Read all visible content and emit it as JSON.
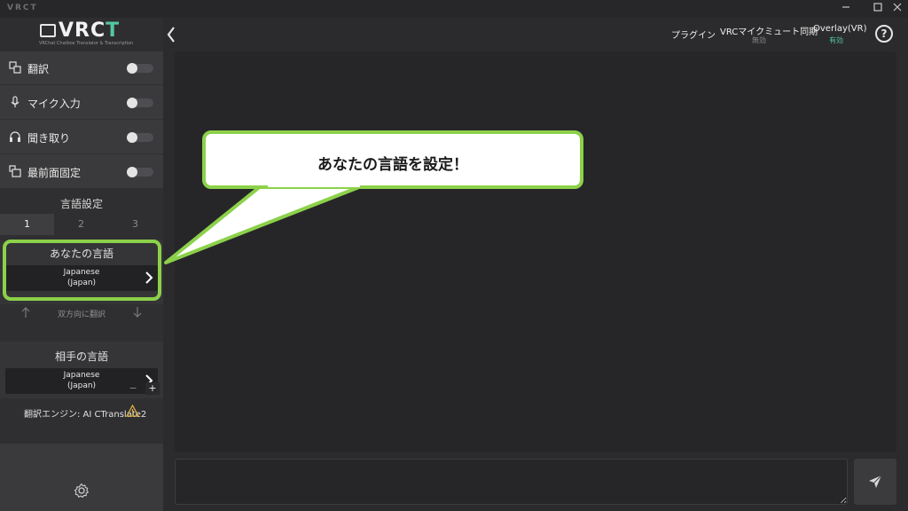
{
  "window": {
    "title": "VRCT"
  },
  "logo": {
    "text_main": "VRC",
    "text_accent": "T",
    "subtitle": "VRChat Chatbox Translator & Transcription"
  },
  "sidebar": {
    "toggles": [
      {
        "label": "翻訳",
        "icon": "translate-icon",
        "enabled": false
      },
      {
        "label": "マイク入力",
        "icon": "microphone-icon",
        "enabled": false
      },
      {
        "label": "聞き取り",
        "icon": "headphones-icon",
        "enabled": false
      },
      {
        "label": "最前面固定",
        "icon": "window-pin-icon",
        "enabled": false
      }
    ],
    "language_settings": {
      "title": "言語設定",
      "tabs": [
        "1",
        "2",
        "3"
      ],
      "active_tab": "1",
      "your_language": {
        "caption": "あなたの言語",
        "value_line1": "Japanese",
        "value_line2": "(Japan)"
      },
      "swap_label": "双方向に翻訳",
      "target_language": {
        "caption": "相手の言語",
        "value_line1": "Japanese",
        "value_line2": "(Japan)"
      },
      "minus_label": "−",
      "plus_label": "+"
    },
    "engine_label": "翻訳エンジン: AI CTranslate2"
  },
  "header": {
    "plugin_label": "プラグイン",
    "mic_mute_sync": {
      "label": "VRCマイクミュート同期",
      "status": "無効"
    },
    "overlay": {
      "label": "Overlay(VR)",
      "status": "有効"
    },
    "help_label": "?"
  },
  "message_input": {
    "value": "",
    "placeholder": ""
  },
  "callout": {
    "text": "あなたの言語を設定！"
  },
  "colors": {
    "accent_green": "#8cd14a",
    "enabled_status": "#53c6a0",
    "disabled_status": "#8a8a8c",
    "warning": "#e0b040"
  }
}
